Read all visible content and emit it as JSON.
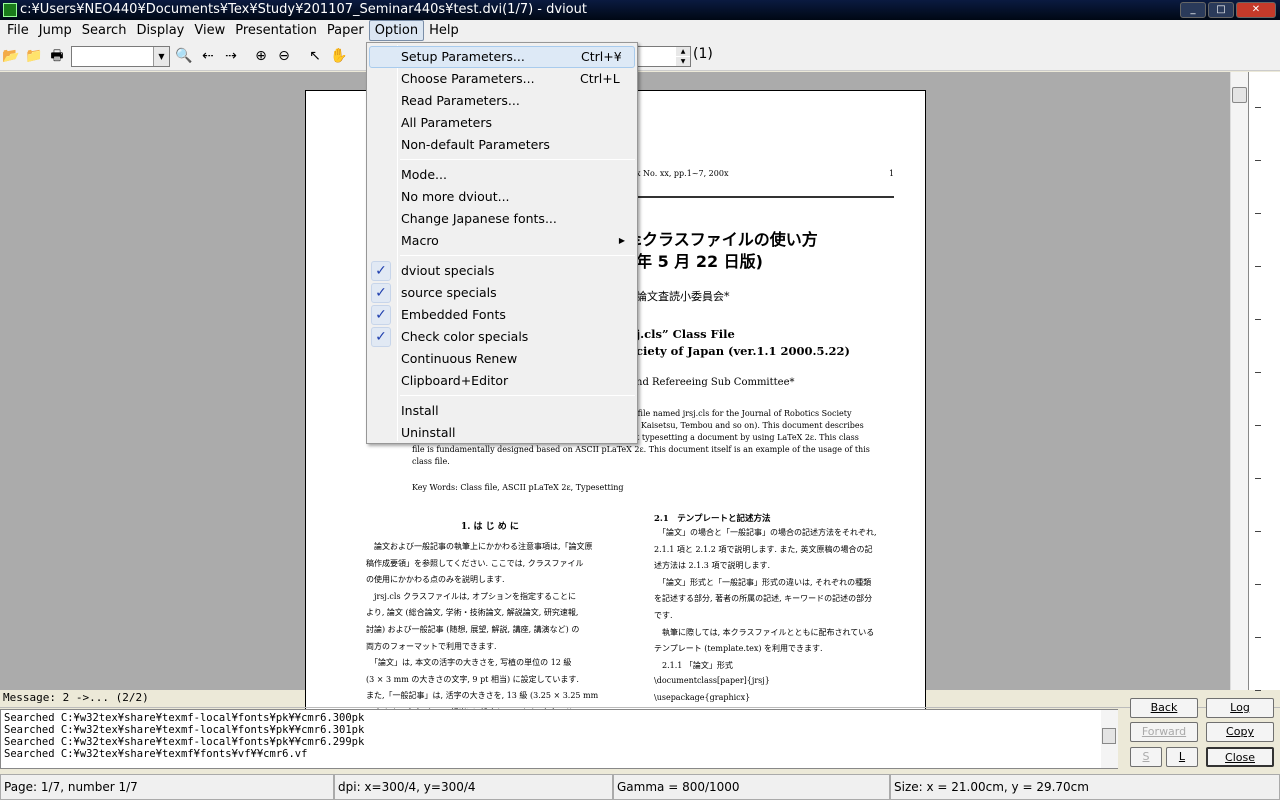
{
  "window": {
    "title": "c:¥Users¥NEO440¥Documents¥Tex¥Study¥201107_Seminar440s¥test.dvi(1/7) - dviout"
  },
  "menubar": [
    "File",
    "Jump",
    "Search",
    "Display",
    "View",
    "Presentation",
    "Paper",
    "Option",
    "Help"
  ],
  "toolbar": {
    "page_spin_value": "",
    "page_spin_label": "(1)",
    "combo_value": ""
  },
  "option_menu": {
    "groups": [
      [
        {
          "label": "Setup Parameters...",
          "shortcut": "Ctrl+¥",
          "highlighted": true
        },
        {
          "label": "Choose Parameters...",
          "shortcut": "Ctrl+L"
        },
        {
          "label": "Read Parameters..."
        },
        {
          "label": "All Parameters"
        },
        {
          "label": "Non-default Parameters"
        }
      ],
      [
        {
          "label": "Mode..."
        },
        {
          "label": "No more dviout..."
        },
        {
          "label": "Change Japanese fonts..."
        },
        {
          "label": "Macro",
          "submenu": true
        }
      ],
      [
        {
          "label": "dviout specials",
          "checked": true
        },
        {
          "label": "source specials",
          "checked": true
        },
        {
          "label": "Embedded Fonts",
          "checked": true
        },
        {
          "label": "Check color specials",
          "checked": true
        },
        {
          "label": "Continuous Renew"
        },
        {
          "label": "Clipboard+Editor"
        }
      ],
      [
        {
          "label": "Install"
        },
        {
          "label": "Uninstall"
        }
      ]
    ]
  },
  "document": {
    "header": "x   No. xx, pp.1~7, 200x",
    "page_no": "1",
    "title1": "2εクラスファイルの使い方",
    "title2": "年 5 月 22 日版)",
    "author_jp": "論文査読小委員会*",
    "etitle1": "j.cls” Class File",
    "etitle2": "ciety of Japan (ver.1.1 2000.5.22)",
    "eauthor": "nd Refereeing Sub Committee*",
    "abs": [
      "s file named jrsj.cls for the Journal of Robotics Society",
      "a, Kaisetsu, Tembou and so on). This document describes",
      "ut typesetting a document by using LaTeX 2ε. This class",
      "file is fundamentally designed based on ASCII pLaTeX 2ε. This document itself is an example of the usage of this",
      "class file."
    ],
    "keywords": "Key Words: Class file, ASCII pLaTeX 2ε, Typesetting",
    "sec1": "1. は じ め に",
    "col1": [
      "　論文および一般記事の執筆上にかかわる注意事項は,「論文原",
      "稿作成要領」を参照してください. ここでは, クラスファイル",
      "の使用にかかわる点のみを説明します.",
      "　jrsj.cls クラスファイルは, オプションを指定することに",
      "より, 論文 (総合論文, 学術・技術論文, 解説論文, 研究速報,",
      "討論) および一般記事 (随想, 展望, 解説, 講座, 講演など) の",
      "両方のフォーマットで利用できます.",
      "　「論文」は, 本文の活字の大きさを, 写植の単位の 12 級",
      "(3 × 3 mm の大きさの文字, 9 pt 相当) に設定しています.",
      "また,「一般記事」は, 活字の大きさを, 13 級 (3.25 × 3.25 mm",
      "の大きさの文字, 10 pt 相当) に設定しています. 本文のサイ"
    ],
    "sec21": "2.1　テンプレートと記述方法",
    "col2": [
      "　「論文」の場合と「一般記事」の場合の記述方法をそれぞれ,",
      "2.1.1 項と 2.1.2 項で説明します. また, 英文原稿の場合の記",
      "述方法は 2.1.3 項で説明します.",
      "　「論文」形式と「一般記事」形式の違いは, それぞれの種類",
      "を記述する部分, 著者の所属の記述, キーワードの記述の部分",
      "です.",
      "　執筆に際しては, 本クラスファイルとともに配布されている",
      "テンプレート (template.tex) を利用できます.",
      "　2.1.1 「論文」形式",
      "\\documentclass[paper]{jrsj}",
      "\\usepackage{graphicx}",
      "\\typeofpaper{学術・技術論文}"
    ]
  },
  "message": "Message: 2 ->... (2/2)",
  "log": [
    "Searched C:¥w32tex¥share¥texmf-local¥fonts¥pk¥¥cmr6.300pk",
    "Searched C:¥w32tex¥share¥texmf-local¥fonts¥pk¥¥cmr6.301pk",
    "Searched C:¥w32tex¥share¥texmf-local¥fonts¥pk¥¥cmr6.299pk",
    "Searched C:¥w32tex¥share¥texmf¥fonts¥vf¥¥cmr6.vf"
  ],
  "buttons": {
    "back": "Back",
    "log": "Log",
    "forward": "Forward",
    "copy": "Copy",
    "s": "S",
    "l": "L",
    "close": "Close"
  },
  "status": {
    "page": "Page: 1/7, number 1/7",
    "dpi": "dpi: x=300/4, y=300/4",
    "gamma": "Gamma = 800/1000",
    "size": "Size: x = 21.00cm, y = 29.70cm"
  }
}
